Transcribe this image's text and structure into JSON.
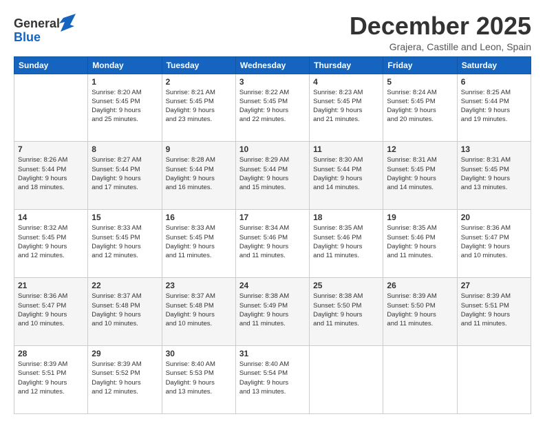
{
  "logo": {
    "line1": "General",
    "line2": "Blue"
  },
  "header": {
    "month": "December 2025",
    "location": "Grajera, Castille and Leon, Spain"
  },
  "weekdays": [
    "Sunday",
    "Monday",
    "Tuesday",
    "Wednesday",
    "Thursday",
    "Friday",
    "Saturday"
  ],
  "weeks": [
    [
      {
        "day": "",
        "info": ""
      },
      {
        "day": "1",
        "info": "Sunrise: 8:20 AM\nSunset: 5:45 PM\nDaylight: 9 hours\nand 25 minutes."
      },
      {
        "day": "2",
        "info": "Sunrise: 8:21 AM\nSunset: 5:45 PM\nDaylight: 9 hours\nand 23 minutes."
      },
      {
        "day": "3",
        "info": "Sunrise: 8:22 AM\nSunset: 5:45 PM\nDaylight: 9 hours\nand 22 minutes."
      },
      {
        "day": "4",
        "info": "Sunrise: 8:23 AM\nSunset: 5:45 PM\nDaylight: 9 hours\nand 21 minutes."
      },
      {
        "day": "5",
        "info": "Sunrise: 8:24 AM\nSunset: 5:45 PM\nDaylight: 9 hours\nand 20 minutes."
      },
      {
        "day": "6",
        "info": "Sunrise: 8:25 AM\nSunset: 5:44 PM\nDaylight: 9 hours\nand 19 minutes."
      }
    ],
    [
      {
        "day": "7",
        "info": "Sunrise: 8:26 AM\nSunset: 5:44 PM\nDaylight: 9 hours\nand 18 minutes."
      },
      {
        "day": "8",
        "info": "Sunrise: 8:27 AM\nSunset: 5:44 PM\nDaylight: 9 hours\nand 17 minutes."
      },
      {
        "day": "9",
        "info": "Sunrise: 8:28 AM\nSunset: 5:44 PM\nDaylight: 9 hours\nand 16 minutes."
      },
      {
        "day": "10",
        "info": "Sunrise: 8:29 AM\nSunset: 5:44 PM\nDaylight: 9 hours\nand 15 minutes."
      },
      {
        "day": "11",
        "info": "Sunrise: 8:30 AM\nSunset: 5:44 PM\nDaylight: 9 hours\nand 14 minutes."
      },
      {
        "day": "12",
        "info": "Sunrise: 8:31 AM\nSunset: 5:45 PM\nDaylight: 9 hours\nand 14 minutes."
      },
      {
        "day": "13",
        "info": "Sunrise: 8:31 AM\nSunset: 5:45 PM\nDaylight: 9 hours\nand 13 minutes."
      }
    ],
    [
      {
        "day": "14",
        "info": "Sunrise: 8:32 AM\nSunset: 5:45 PM\nDaylight: 9 hours\nand 12 minutes."
      },
      {
        "day": "15",
        "info": "Sunrise: 8:33 AM\nSunset: 5:45 PM\nDaylight: 9 hours\nand 12 minutes."
      },
      {
        "day": "16",
        "info": "Sunrise: 8:33 AM\nSunset: 5:45 PM\nDaylight: 9 hours\nand 11 minutes."
      },
      {
        "day": "17",
        "info": "Sunrise: 8:34 AM\nSunset: 5:46 PM\nDaylight: 9 hours\nand 11 minutes."
      },
      {
        "day": "18",
        "info": "Sunrise: 8:35 AM\nSunset: 5:46 PM\nDaylight: 9 hours\nand 11 minutes."
      },
      {
        "day": "19",
        "info": "Sunrise: 8:35 AM\nSunset: 5:46 PM\nDaylight: 9 hours\nand 11 minutes."
      },
      {
        "day": "20",
        "info": "Sunrise: 8:36 AM\nSunset: 5:47 PM\nDaylight: 9 hours\nand 10 minutes."
      }
    ],
    [
      {
        "day": "21",
        "info": "Sunrise: 8:36 AM\nSunset: 5:47 PM\nDaylight: 9 hours\nand 10 minutes."
      },
      {
        "day": "22",
        "info": "Sunrise: 8:37 AM\nSunset: 5:48 PM\nDaylight: 9 hours\nand 10 minutes."
      },
      {
        "day": "23",
        "info": "Sunrise: 8:37 AM\nSunset: 5:48 PM\nDaylight: 9 hours\nand 10 minutes."
      },
      {
        "day": "24",
        "info": "Sunrise: 8:38 AM\nSunset: 5:49 PM\nDaylight: 9 hours\nand 11 minutes."
      },
      {
        "day": "25",
        "info": "Sunrise: 8:38 AM\nSunset: 5:50 PM\nDaylight: 9 hours\nand 11 minutes."
      },
      {
        "day": "26",
        "info": "Sunrise: 8:39 AM\nSunset: 5:50 PM\nDaylight: 9 hours\nand 11 minutes."
      },
      {
        "day": "27",
        "info": "Sunrise: 8:39 AM\nSunset: 5:51 PM\nDaylight: 9 hours\nand 11 minutes."
      }
    ],
    [
      {
        "day": "28",
        "info": "Sunrise: 8:39 AM\nSunset: 5:51 PM\nDaylight: 9 hours\nand 12 minutes."
      },
      {
        "day": "29",
        "info": "Sunrise: 8:39 AM\nSunset: 5:52 PM\nDaylight: 9 hours\nand 12 minutes."
      },
      {
        "day": "30",
        "info": "Sunrise: 8:40 AM\nSunset: 5:53 PM\nDaylight: 9 hours\nand 13 minutes."
      },
      {
        "day": "31",
        "info": "Sunrise: 8:40 AM\nSunset: 5:54 PM\nDaylight: 9 hours\nand 13 minutes."
      },
      {
        "day": "",
        "info": ""
      },
      {
        "day": "",
        "info": ""
      },
      {
        "day": "",
        "info": ""
      }
    ]
  ]
}
